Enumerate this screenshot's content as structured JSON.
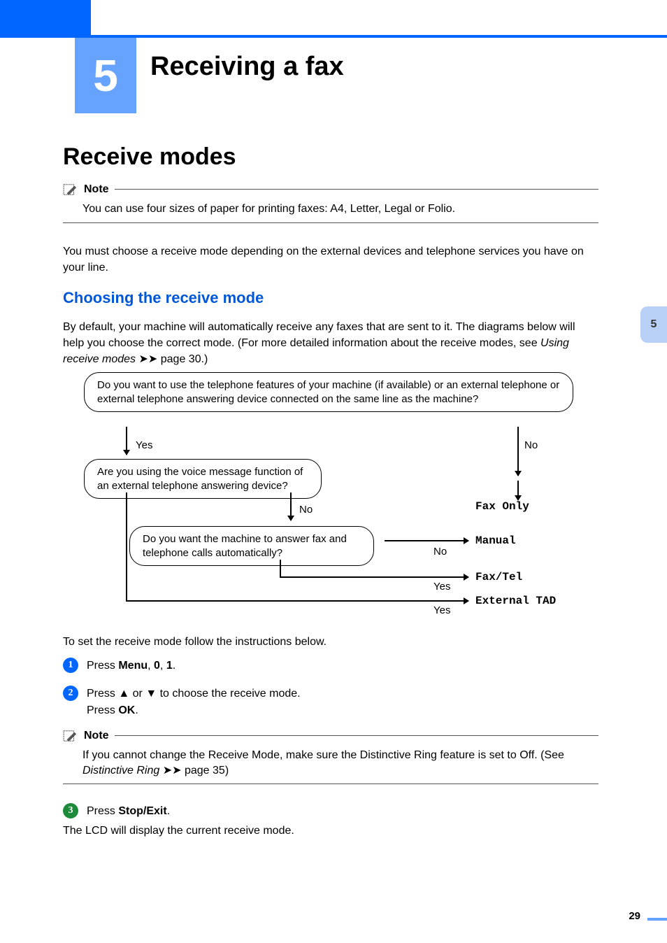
{
  "chapter": {
    "number": "5",
    "title": "Receiving a fax"
  },
  "section_title": "Receive modes",
  "note1": {
    "label": "Note",
    "body": "You can use four sizes of paper for printing faxes: A4, Letter, Legal or Folio."
  },
  "para_after_note1": "You must choose a receive mode depending on the external devices and telephone services you have on your line.",
  "subsection_title": "Choosing the receive mode",
  "intro_para_parts": {
    "p1": "By default, your machine will automatically receive any faxes that are sent to it. The diagrams below will help you you choose the correct mode. (For more detailed information about the receive modes, see ",
    "p1a": "By default, your machine will automatically receive any faxes that are sent to it. The diagrams below will help you choose the correct mode. (For more detailed information about the receive modes, see ",
    "link": "Using receive modes",
    "p2": " page 30.)"
  },
  "flow": {
    "q1": "Do you want to use the telephone features of your machine (if available) or an external telephone or external telephone answering device connected on the same line as the machine?",
    "q2": "Are you using the voice message function of an external telephone answering device?",
    "q3": "Do you want the machine to answer fax and telephone calls automatically?",
    "yes": "Yes",
    "no": "No",
    "mode_fax_only": "Fax Only",
    "mode_manual": "Manual",
    "mode_fax_tel": "Fax/Tel",
    "mode_ext_tad": "External TAD"
  },
  "instr_intro": "To set the receive mode follow the instructions below.",
  "steps": {
    "s1": {
      "num": "1",
      "pre": "Press ",
      "k1": "Menu",
      "mid1": ", ",
      "k2": "0",
      "mid2": ", ",
      "k3": "1",
      "post": "."
    },
    "s2": {
      "num": "2",
      "line1_pre": "Press ",
      "line1_sym1": "▲",
      "line1_mid": " or ",
      "line1_sym2": "▼",
      "line1_post": " to choose the receive mode.",
      "line2_pre": "Press ",
      "line2_key": "OK",
      "line2_post": "."
    },
    "s3": {
      "num": "3",
      "pre": "Press ",
      "k1": "Stop/Exit",
      "post": "."
    }
  },
  "note2": {
    "label": "Note",
    "body_pre": "If you cannot change the Receive Mode, make sure the Distinctive Ring feature is set to Off. (See ",
    "link": "Distinctive Ring",
    "body_post": " page 35)"
  },
  "final_para": "The LCD will display the current receive mode.",
  "page_number": "29",
  "thumb_tab": "5"
}
